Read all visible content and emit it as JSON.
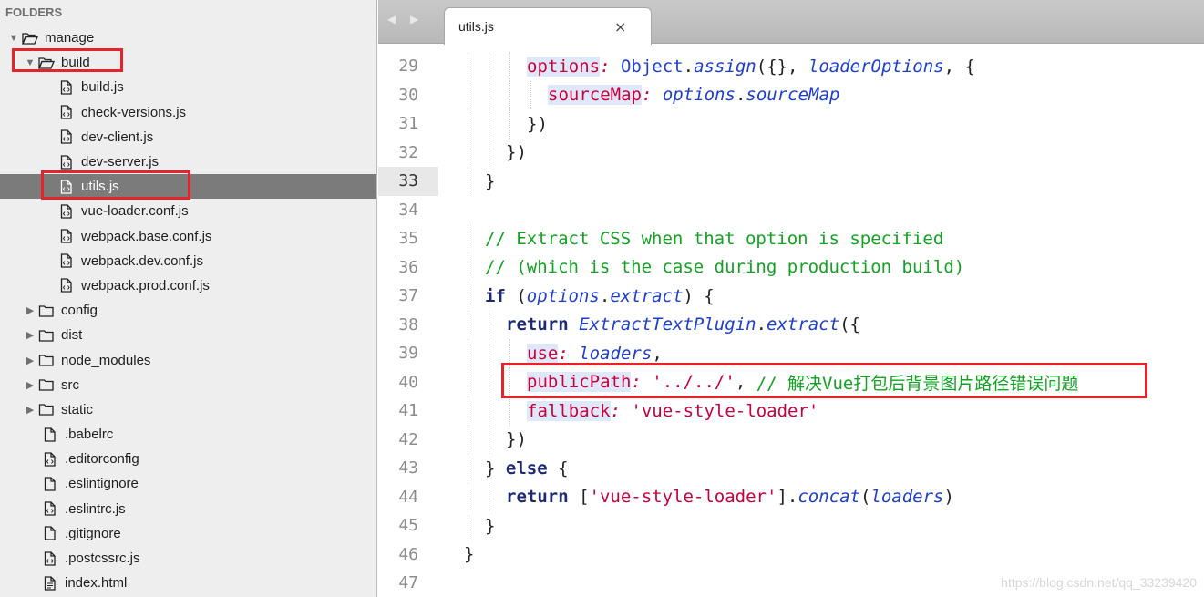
{
  "sidebar": {
    "header": "FOLDERS",
    "tree": [
      {
        "label": "manage",
        "kind": "folder-open",
        "indent": 0,
        "disclosure": "open",
        "selected": false
      },
      {
        "label": "build",
        "kind": "folder-open",
        "indent": 1,
        "disclosure": "open",
        "selected": false
      },
      {
        "label": "build.js",
        "kind": "file-js",
        "indent": 3,
        "disclosure": "none",
        "selected": false
      },
      {
        "label": "check-versions.js",
        "kind": "file-js",
        "indent": 3,
        "disclosure": "none",
        "selected": false
      },
      {
        "label": "dev-client.js",
        "kind": "file-js",
        "indent": 3,
        "disclosure": "none",
        "selected": false
      },
      {
        "label": "dev-server.js",
        "kind": "file-js",
        "indent": 3,
        "disclosure": "none",
        "selected": false
      },
      {
        "label": "utils.js",
        "kind": "file-js",
        "indent": 3,
        "disclosure": "none",
        "selected": true
      },
      {
        "label": "vue-loader.conf.js",
        "kind": "file-js",
        "indent": 3,
        "disclosure": "none",
        "selected": false
      },
      {
        "label": "webpack.base.conf.js",
        "kind": "file-js",
        "indent": 3,
        "disclosure": "none",
        "selected": false
      },
      {
        "label": "webpack.dev.conf.js",
        "kind": "file-js",
        "indent": 3,
        "disclosure": "none",
        "selected": false
      },
      {
        "label": "webpack.prod.conf.js",
        "kind": "file-js",
        "indent": 3,
        "disclosure": "none",
        "selected": false
      },
      {
        "label": "config",
        "kind": "folder",
        "indent": 1,
        "disclosure": "closed",
        "selected": false
      },
      {
        "label": "dist",
        "kind": "folder",
        "indent": 1,
        "disclosure": "closed",
        "selected": false
      },
      {
        "label": "node_modules",
        "kind": "folder",
        "indent": 1,
        "disclosure": "closed",
        "selected": false
      },
      {
        "label": "src",
        "kind": "folder",
        "indent": 1,
        "disclosure": "closed",
        "selected": false
      },
      {
        "label": "static",
        "kind": "folder",
        "indent": 1,
        "disclosure": "closed",
        "selected": false
      },
      {
        "label": ".babelrc",
        "kind": "file",
        "indent": 2,
        "disclosure": "none",
        "selected": false
      },
      {
        "label": ".editorconfig",
        "kind": "file-js",
        "indent": 2,
        "disclosure": "none",
        "selected": false
      },
      {
        "label": ".eslintignore",
        "kind": "file",
        "indent": 2,
        "disclosure": "none",
        "selected": false
      },
      {
        "label": ".eslintrc.js",
        "kind": "file-js",
        "indent": 2,
        "disclosure": "none",
        "selected": false
      },
      {
        "label": ".gitignore",
        "kind": "file",
        "indent": 2,
        "disclosure": "none",
        "selected": false
      },
      {
        "label": ".postcssrc.js",
        "kind": "file-js",
        "indent": 2,
        "disclosure": "none",
        "selected": false
      },
      {
        "label": "index.html",
        "kind": "file-html",
        "indent": 2,
        "disclosure": "none",
        "selected": false
      }
    ]
  },
  "editor": {
    "tab_title": "utils.js",
    "tab_close": "×",
    "nav_arrows": "◀ ▶",
    "current_line": 33,
    "lines": [
      {
        "num": "29",
        "indent": 4,
        "tokens": [
          [
            "prop hl",
            "options"
          ],
          [
            "ital t-prop",
            ":"
          ],
          [
            "plain",
            " "
          ],
          [
            "blue",
            "Object"
          ],
          [
            "plain",
            "."
          ],
          [
            "blue ital",
            "assign"
          ],
          [
            "plain",
            "({}, "
          ],
          [
            "blue ital",
            "loaderOptions"
          ],
          [
            "plain",
            ", {"
          ]
        ]
      },
      {
        "num": "30",
        "indent": 5,
        "tokens": [
          [
            "prop hl",
            "sourceMap"
          ],
          [
            "ital t-prop",
            ":"
          ],
          [
            "plain",
            " "
          ],
          [
            "blue ital",
            "options"
          ],
          [
            "plain",
            "."
          ],
          [
            "blue ital",
            "sourceMap"
          ]
        ]
      },
      {
        "num": "31",
        "indent": 4,
        "tokens": [
          [
            "plain",
            "})"
          ]
        ]
      },
      {
        "num": "32",
        "indent": 3,
        "tokens": [
          [
            "plain",
            "})"
          ]
        ]
      },
      {
        "num": "33",
        "indent": 2,
        "tokens": [
          [
            "plain",
            "}"
          ]
        ]
      },
      {
        "num": "34",
        "indent": 0,
        "tokens": []
      },
      {
        "num": "35",
        "indent": 2,
        "tokens": [
          [
            "comment",
            "// Extract CSS when that option is specified"
          ]
        ]
      },
      {
        "num": "36",
        "indent": 2,
        "tokens": [
          [
            "comment",
            "// (which is the case during production build)"
          ]
        ]
      },
      {
        "num": "37",
        "indent": 2,
        "tokens": [
          [
            "kw",
            "if"
          ],
          [
            "plain",
            " ("
          ],
          [
            "blue ital",
            "options"
          ],
          [
            "plain",
            "."
          ],
          [
            "blue ital",
            "extract"
          ],
          [
            "plain",
            ") {"
          ]
        ]
      },
      {
        "num": "38",
        "indent": 3,
        "tokens": [
          [
            "kw",
            "return"
          ],
          [
            "plain",
            " "
          ],
          [
            "blue ital",
            "ExtractTextPlugin"
          ],
          [
            "plain",
            "."
          ],
          [
            "blue ital",
            "extract"
          ],
          [
            "plain",
            "({"
          ]
        ]
      },
      {
        "num": "39",
        "indent": 4,
        "tokens": [
          [
            "prop hl",
            "use"
          ],
          [
            "ital t-prop",
            ":"
          ],
          [
            "plain",
            " "
          ],
          [
            "blue ital",
            "loaders"
          ],
          [
            "plain",
            ","
          ]
        ]
      },
      {
        "num": "40",
        "indent": 4,
        "tokens": [
          [
            "prop hl",
            "publicPath"
          ],
          [
            "ital t-prop",
            ":"
          ],
          [
            "plain",
            " "
          ],
          [
            "str",
            "'../../'"
          ],
          [
            "plain",
            ", "
          ],
          [
            "comment",
            "// 解决Vue打包后背景图片路径错误问题"
          ]
        ]
      },
      {
        "num": "41",
        "indent": 4,
        "tokens": [
          [
            "prop hl",
            "fallback"
          ],
          [
            "ital t-prop",
            ":"
          ],
          [
            "plain",
            " "
          ],
          [
            "str",
            "'vue-style-loader'"
          ]
        ]
      },
      {
        "num": "42",
        "indent": 3,
        "tokens": [
          [
            "plain",
            "})"
          ]
        ]
      },
      {
        "num": "43",
        "indent": 2,
        "tokens": [
          [
            "plain",
            "} "
          ],
          [
            "kw",
            "else"
          ],
          [
            "plain",
            " {"
          ]
        ]
      },
      {
        "num": "44",
        "indent": 3,
        "tokens": [
          [
            "kw",
            "return"
          ],
          [
            "plain",
            " ["
          ],
          [
            "str",
            "'vue-style-loader'"
          ],
          [
            "plain",
            "]."
          ],
          [
            "blue ital",
            "concat"
          ],
          [
            "plain",
            "("
          ],
          [
            "blue ital",
            "loaders"
          ],
          [
            "plain",
            ")"
          ]
        ]
      },
      {
        "num": "45",
        "indent": 2,
        "tokens": [
          [
            "plain",
            "}"
          ]
        ]
      },
      {
        "num": "46",
        "indent": 1,
        "tokens": [
          [
            "plain",
            "}"
          ]
        ]
      },
      {
        "num": "47",
        "indent": 0,
        "tokens": []
      }
    ]
  },
  "watermark": "https://blog.csdn.net/qq_33239420",
  "colors": {
    "highlight_box": "#e6232b",
    "selected_row": "#7b7b7b"
  }
}
